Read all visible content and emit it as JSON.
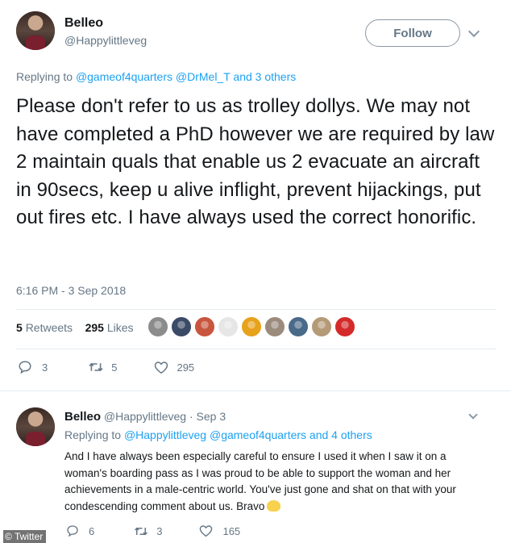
{
  "main_tweet": {
    "author_name": "Belleo",
    "author_handle": "@Happylittleveg",
    "follow_label": "Follow",
    "replying_prefix": "Replying to ",
    "replying_mentions": "@gameof4quarters @DrMel_T",
    "replying_suffix": " and 3 others",
    "text": "Please don't refer to us as trolley dollys. We may not have completed a PhD however we are required by law 2 maintain quals that enable us 2 evacuate an aircraft in 90secs, keep u alive inflight, prevent hijackings, put out fires etc. I have always used the correct honorific.",
    "timestamp": "6:16 PM - 3 Sep 2018",
    "retweets_count": "5",
    "retweets_label": "Retweets",
    "likes_count": "295",
    "likes_label": "Likes",
    "likers": [
      {
        "icon": "liker-avatar-gray",
        "color": "#8c8c8c"
      },
      {
        "icon": "liker-avatar-dark-blue",
        "color": "#3b4a66"
      },
      {
        "icon": "liker-avatar-sheep",
        "color": "#c8553d"
      },
      {
        "icon": "liker-avatar-symbol",
        "color": "#e6e6e6"
      },
      {
        "icon": "liker-avatar-sunflower",
        "color": "#e7a21b"
      },
      {
        "icon": "liker-avatar-hedgehog",
        "color": "#9a8b7d"
      },
      {
        "icon": "liker-avatar-person",
        "color": "#4a6a8a"
      },
      {
        "icon": "liker-avatar-portrait",
        "color": "#b59a78"
      },
      {
        "icon": "liker-avatar-red",
        "color": "#d42a2a"
      }
    ],
    "reply_count": "3",
    "retweet_count": "5",
    "like_count": "295"
  },
  "reply_tweet": {
    "author_name": "Belleo",
    "author_handle": "@Happylittleveg",
    "date": "Sep 3",
    "separator": " · ",
    "replying_prefix": "Replying to ",
    "replying_mentions": "@Happylittleveg @gameof4quarters",
    "replying_suffix": " and 4 others",
    "text": "And I have always been especially careful to ensure I used it when I saw it on a woman's boarding pass as I was proud to be able to support the woman and her achievements in a male-centric world. You've just gone and shat on that with your condescending comment about us. Bravo",
    "reply_count": "6",
    "retweet_count": "3",
    "like_count": "165"
  },
  "watermark": "© Twitter",
  "colors": {
    "link": "#1da1f2",
    "muted": "#657786",
    "text": "#14171a",
    "divider": "#e6ecf0"
  }
}
